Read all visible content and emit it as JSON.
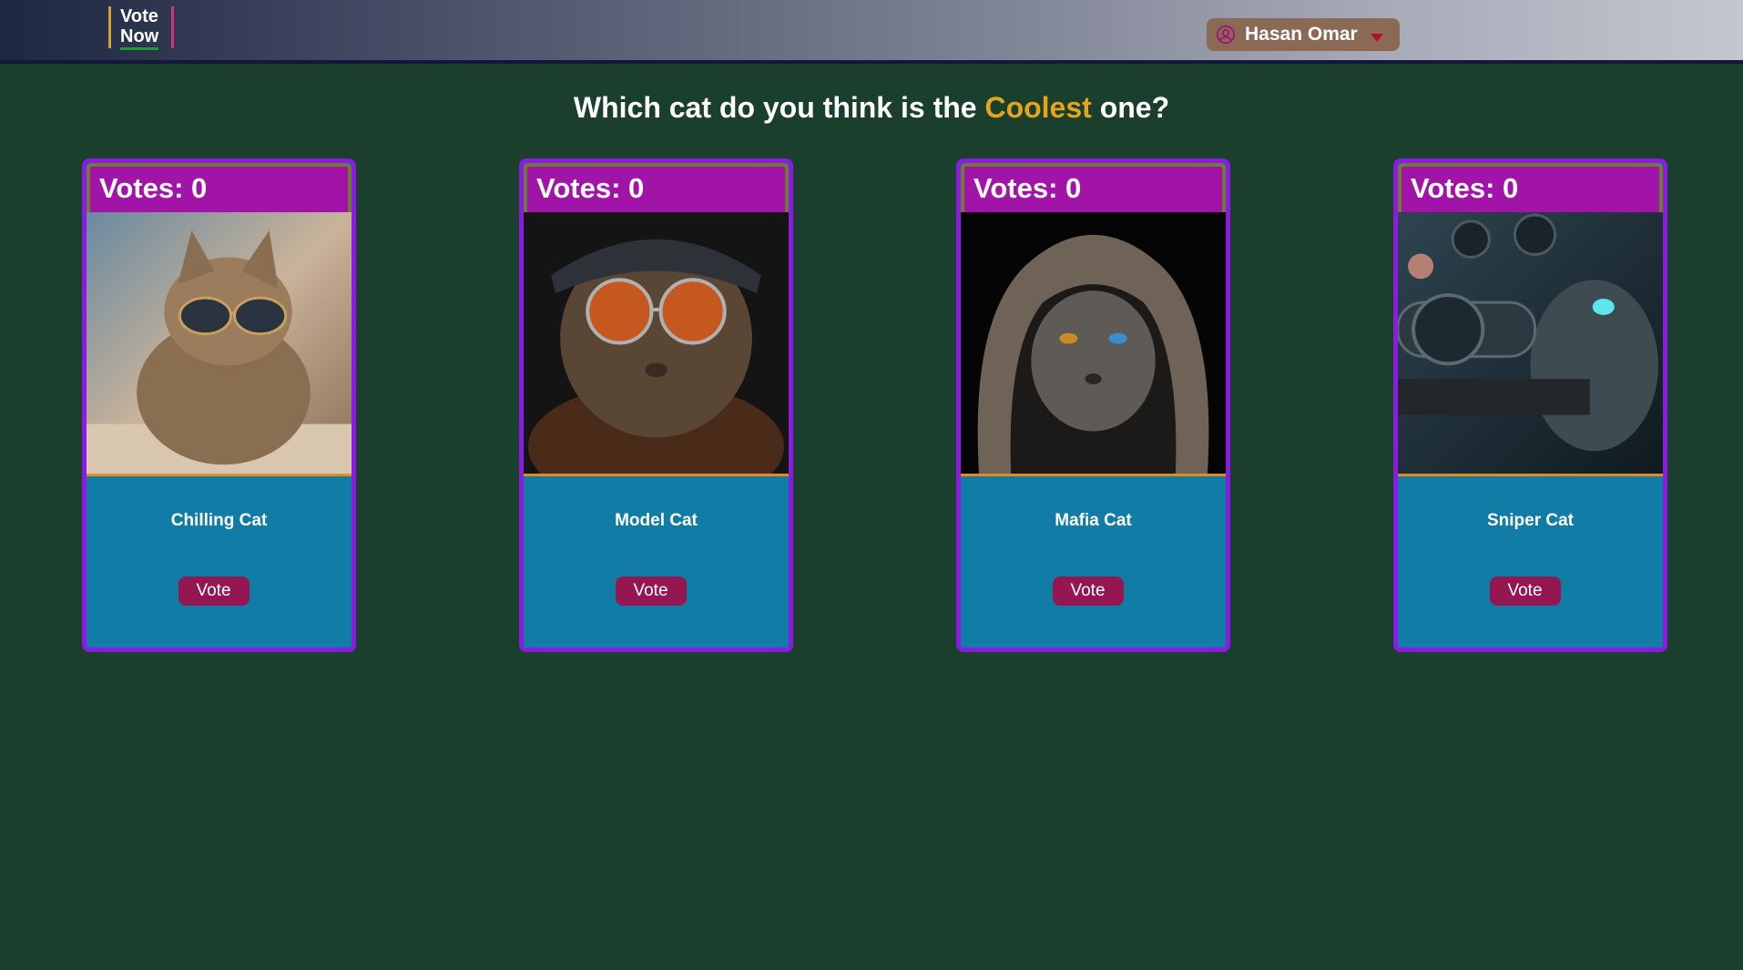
{
  "header": {
    "logo_line1": "Vote",
    "logo_line2": "Now",
    "user_name": "Hasan Omar"
  },
  "headline": {
    "prefix": "Which cat do you think is the ",
    "highlight": "Coolest",
    "suffix": " one?"
  },
  "cards": [
    {
      "votes": "Votes: 0",
      "name": "Chilling Cat",
      "vote_label": "Vote"
    },
    {
      "votes": "Votes: 0",
      "name": "Model Cat",
      "vote_label": "Vote"
    },
    {
      "votes": "Votes: 0",
      "name": "Mafia Cat",
      "vote_label": "Vote"
    },
    {
      "votes": "Votes: 0",
      "name": "Sniper Cat",
      "vote_label": "Vote"
    }
  ],
  "colors": {
    "background": "#1a3f2c",
    "card_header": "#a214a8",
    "card_body": "#117ca6",
    "card_border": "#8b1be0",
    "vote_button": "#951752",
    "highlight": "#e6a31e"
  }
}
